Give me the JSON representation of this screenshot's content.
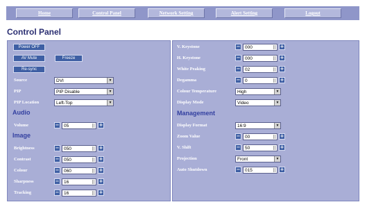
{
  "nav": {
    "home": "Home",
    "control_panel": "Control Panel",
    "network_setting": "Network Setting",
    "alert_setting": "Alert Setting",
    "logout": "Logout"
  },
  "page_title": "Control Panel",
  "left": {
    "power_off": "Power OFF",
    "av_mute": "AV Mute",
    "freeze": "Freeze",
    "resync": "Re-sync",
    "source": {
      "label": "Source",
      "value": "DVI"
    },
    "pip": {
      "label": "PIP",
      "value": "PIP Disable"
    },
    "pip_location": {
      "label": "PIP Location",
      "value": "Left-Top"
    },
    "audio_heading": "Audio",
    "volume": {
      "label": "Volume",
      "value": "05"
    },
    "image_heading": "Image",
    "brightness": {
      "label": "Brightness",
      "value": "050"
    },
    "contrast": {
      "label": "Contrast",
      "value": "050"
    },
    "colour": {
      "label": "Colour",
      "value": "060"
    },
    "sharpness": {
      "label": "Sharpness",
      "value": "16"
    },
    "tracking": {
      "label": "Tracking",
      "value": "16"
    }
  },
  "right": {
    "v_keystone": {
      "label": "V. Keystone",
      "value": "000"
    },
    "h_keystone": {
      "label": "H. Keystone",
      "value": "000"
    },
    "white_peaking": {
      "label": "White Peaking",
      "value": "02"
    },
    "degamma": {
      "label": "Degamma",
      "value": "0"
    },
    "colour_temperature": {
      "label": "Colour Temperature",
      "value": "High"
    },
    "display_mode": {
      "label": "Display Mode",
      "value": "Video"
    },
    "management_heading": "Management",
    "display_format": {
      "label": "Display Format",
      "value": "16:9"
    },
    "zoom_value": {
      "label": "Zoom Value",
      "value": "00"
    },
    "v_shift": {
      "label": "V. Shift",
      "value": "50"
    },
    "projection": {
      "label": "Projection",
      "value": "Front"
    },
    "auto_shutdown": {
      "label": "Auto Shutdown",
      "value": "015"
    }
  },
  "icons": {
    "decrement": "minus-icon",
    "increment": "plus-icon",
    "dropdown": "chevron-down-icon"
  },
  "colors": {
    "nav_bar": "#8f96c9",
    "panel": "#a9aed6",
    "button": "#3e5fa4",
    "title": "#2b2f72",
    "section": "#3340a0"
  }
}
